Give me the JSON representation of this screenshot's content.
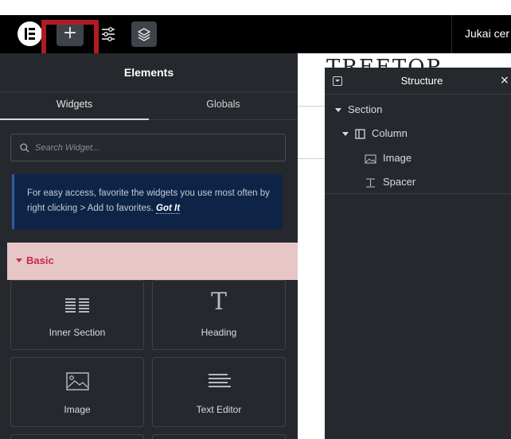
{
  "toolbar": {
    "add_label": "+",
    "site_title": "Jukai cer"
  },
  "panel": {
    "title": "Elements",
    "tabs": [
      "Widgets",
      "Globals"
    ],
    "search_placeholder": "Search Widget...",
    "notice": {
      "text": "For easy access, favorite the widgets you use most often by right clicking > Add to favorites.",
      "link": "Got It"
    },
    "category": "Basic",
    "widgets": [
      "Inner Section",
      "Heading",
      "Image",
      "Text Editor"
    ]
  },
  "canvas": {
    "title": "TREETOP"
  },
  "structure": {
    "title": "Structure",
    "close": "×",
    "items": [
      "Section",
      "Column",
      "Image",
      "Spacer"
    ]
  },
  "colors": {
    "toolbar_bg": "#000000",
    "panel_bg": "#25282c",
    "highlight": "#b01c22",
    "category_bg": "#e7c6c8",
    "category_text": "#c72a4c",
    "notice_bg": "#0e2447"
  },
  "icons": [
    "elementor-logo-icon",
    "plus-icon",
    "settings-sliders-icon",
    "layers-icon",
    "search-icon",
    "inner-section-icon",
    "heading-icon",
    "image-icon",
    "text-editor-icon",
    "section-caret-icon",
    "column-icon",
    "spacer-icon",
    "close-icon"
  ]
}
